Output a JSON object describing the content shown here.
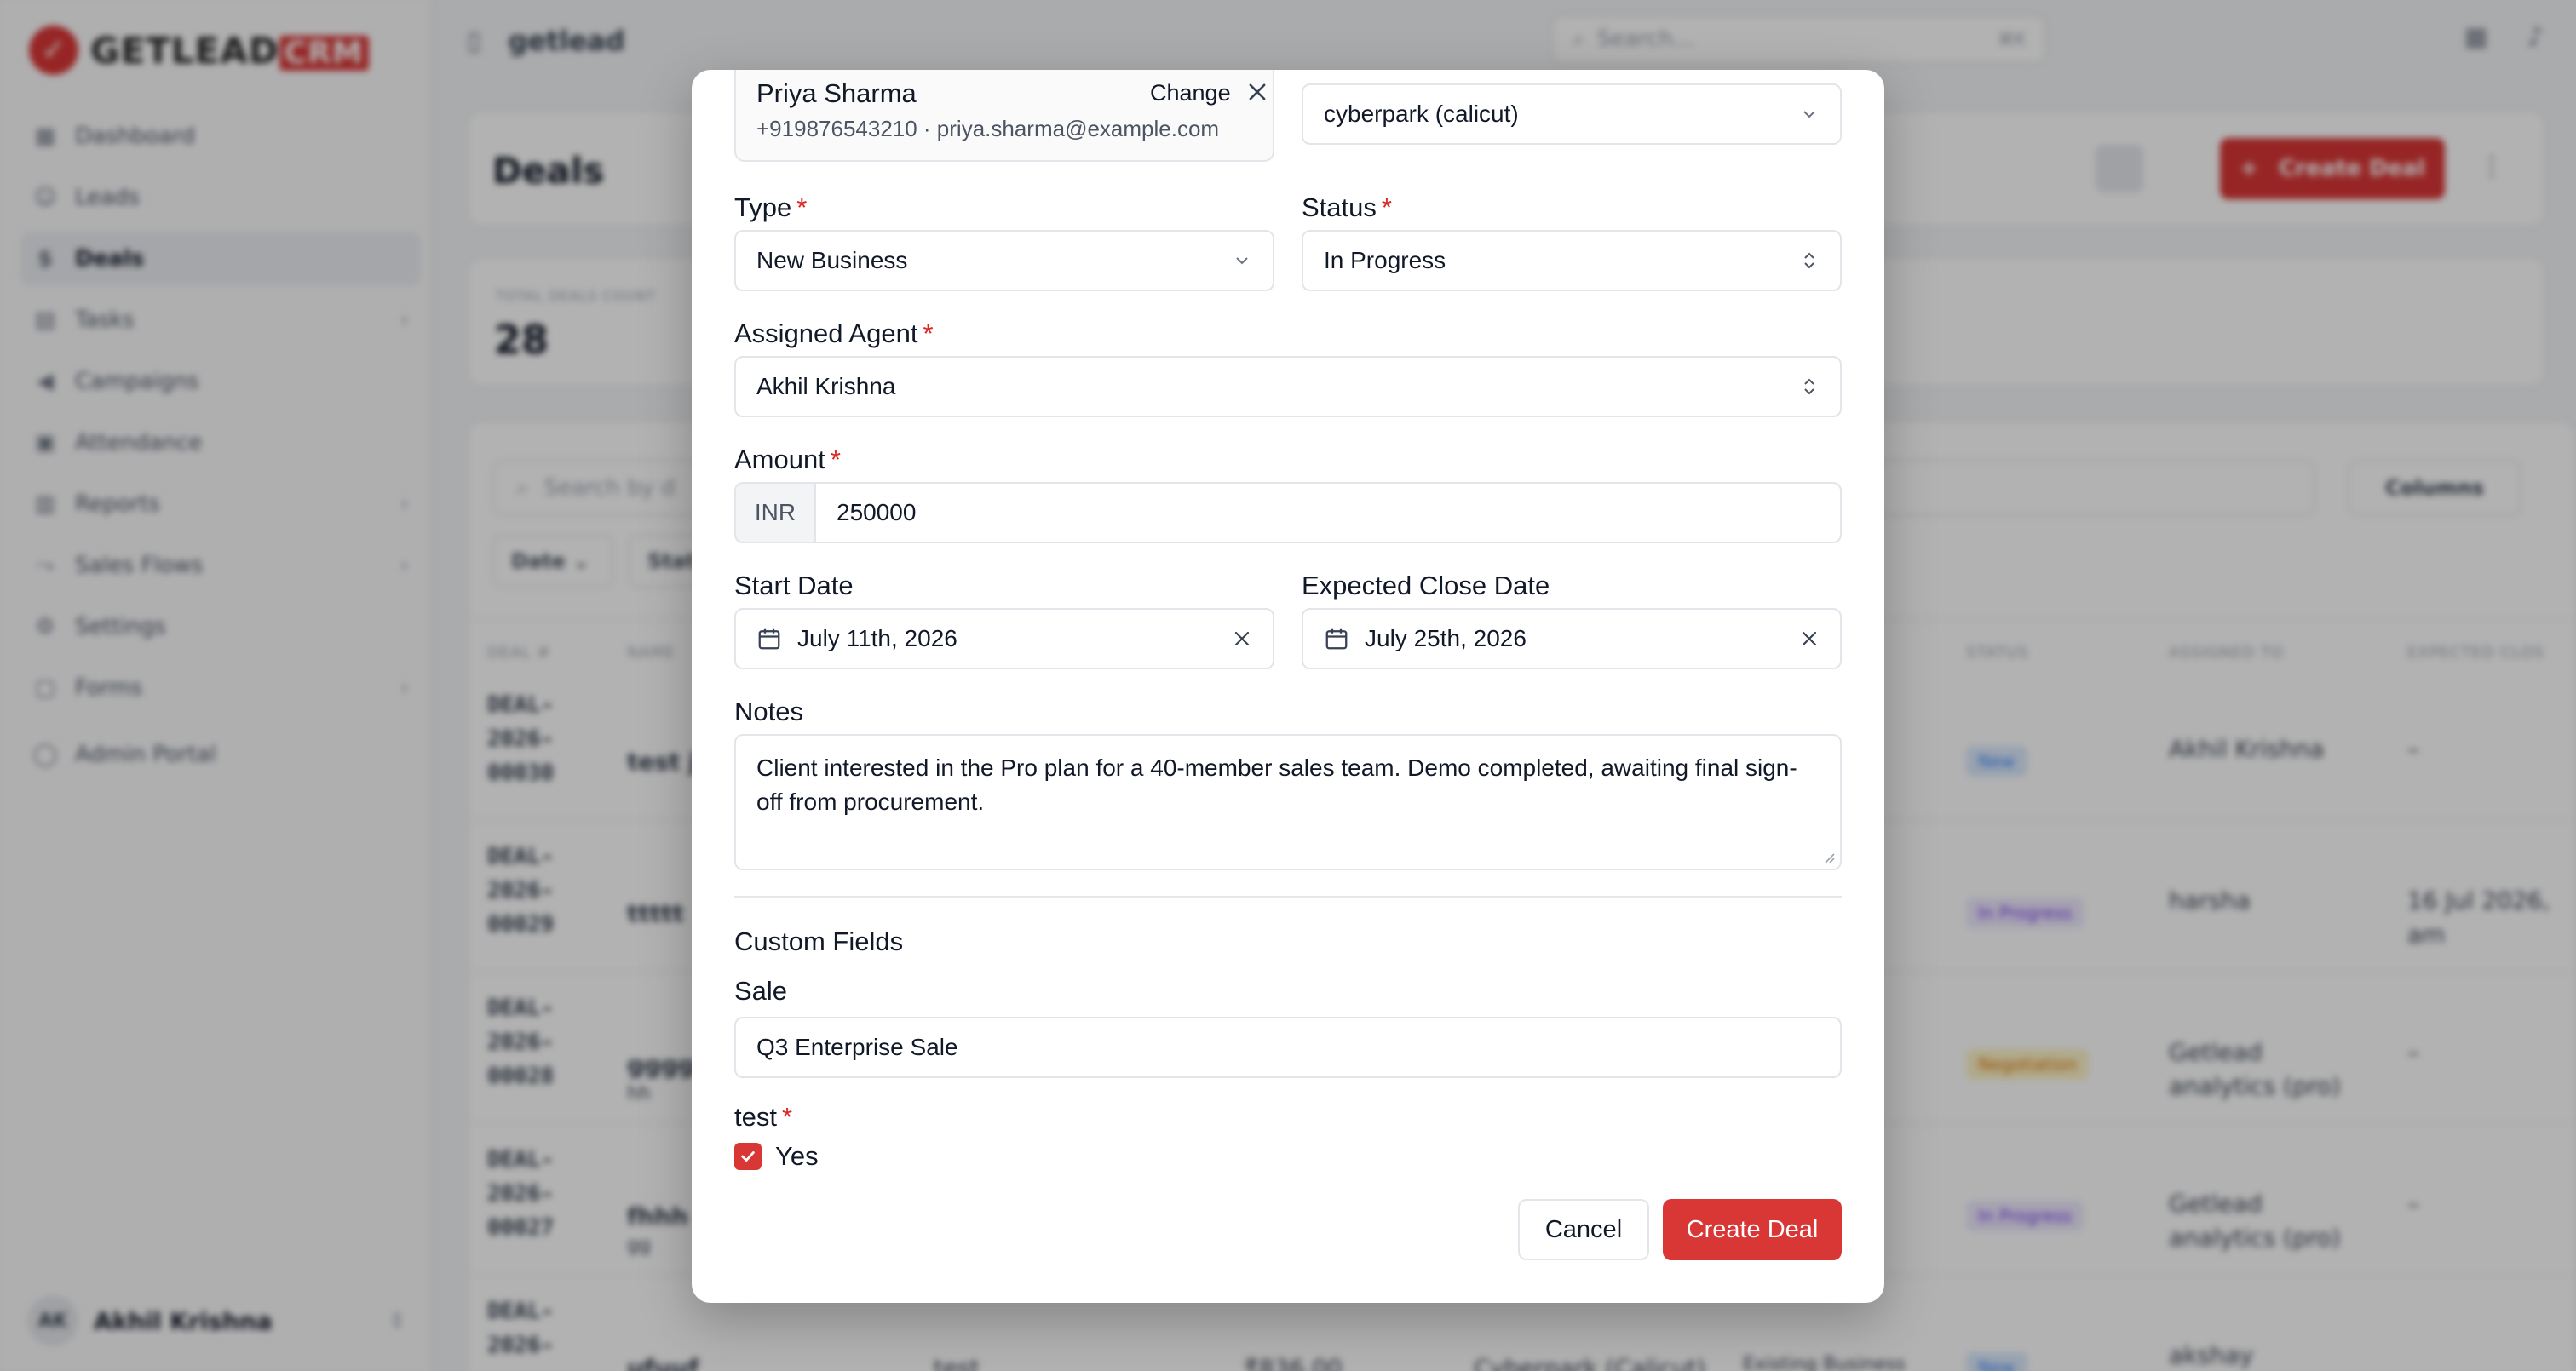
{
  "app": {
    "logo": {
      "mark": "✓",
      "text": "GETLEAD",
      "badge": "CRM"
    },
    "workspace": "getlead",
    "search_placeholder": "Search...",
    "search_shortcut": "⌘K",
    "nav": [
      {
        "label": "Dashboard",
        "icon": "grid-icon",
        "glyph": "▦",
        "has_children": false,
        "active": false
      },
      {
        "label": "Leads",
        "icon": "users-icon",
        "glyph": "☺",
        "has_children": false,
        "active": false
      },
      {
        "label": "Deals",
        "icon": "dollar-icon",
        "glyph": "$",
        "has_children": false,
        "active": true
      },
      {
        "label": "Tasks",
        "icon": "clipboard-icon",
        "glyph": "▤",
        "has_children": true,
        "active": false
      },
      {
        "label": "Campaigns",
        "icon": "megaphone-icon",
        "glyph": "◀",
        "has_children": false,
        "active": false
      },
      {
        "label": "Attendance",
        "icon": "calendar-icon",
        "glyph": "▣",
        "has_children": false,
        "active": false
      },
      {
        "label": "Reports",
        "icon": "bar-chart-icon",
        "glyph": "▥",
        "has_children": true,
        "active": false
      },
      {
        "label": "Sales Flows",
        "icon": "flow-icon",
        "glyph": "⤳",
        "has_children": true,
        "active": false
      },
      {
        "label": "Settings",
        "icon": "gear-icon",
        "glyph": "⚙",
        "has_children": false,
        "active": false
      },
      {
        "label": "Forms",
        "icon": "form-icon",
        "glyph": "▢",
        "has_children": true,
        "active": false
      },
      {
        "label": "Admin Portal",
        "icon": "shield-icon",
        "glyph": "◯",
        "has_children": false,
        "active": false
      }
    ],
    "user": {
      "initials": "AK",
      "name": "Akhil Krishna"
    }
  },
  "page": {
    "title": "Deals",
    "create_button": "Create Deal",
    "stat_label": "TOTAL DEALS COUNT",
    "stat_value": "28",
    "search_placeholder": "Search by d",
    "columns_button": "Columns",
    "filters": [
      "Date",
      "Stat"
    ],
    "table_headers": [
      "DEAL #",
      "NAME",
      "STATUS",
      "ASSIGNED TO",
      "EXPECTED CLOS"
    ],
    "rows": [
      {
        "deal": "DEAL-\n2026-\n00030",
        "name": "test ju",
        "sub": "",
        "status": "New",
        "status_color": "#dbeafe",
        "status_text": "#3b82f6",
        "assigned": "Akhil Krishna",
        "expected": "–"
      },
      {
        "deal": "DEAL-\n2026-\n00029",
        "name": "ttttt",
        "sub": "",
        "status": "In Progress",
        "status_color": "#ede9fe",
        "status_text": "#7c3aed",
        "assigned": "harsha",
        "expected": "16 Jul 2026,\nam"
      },
      {
        "deal": "DEAL-\n2026-\n00028",
        "name": "gggg",
        "sub": "hh",
        "status": "Negotiation",
        "status_color": "#fef3c7",
        "status_text": "#d97706",
        "assigned": "Getlead\nanalytics (pro)",
        "expected": "–"
      },
      {
        "deal": "DEAL-\n2026-\n00027",
        "name": "fhhh",
        "sub": "gg",
        "status": "In Progress",
        "status_color": "#ede9fe",
        "status_text": "#7c3aed",
        "assigned": "Getlead\nanalytics (pro)",
        "expected": "–"
      },
      {
        "deal": "DEAL-\n2026-",
        "name": "ufuuf",
        "sub": "",
        "status": "New",
        "status_color": "#dbeafe",
        "status_text": "#3b82f6",
        "assigned": "akshay",
        "expected": ""
      }
    ],
    "row_extra": {
      "col_a": "test",
      "col_b": "₹836.00",
      "col_c": "Cyberpark (Calicut)",
      "col_d": "Existing Business"
    }
  },
  "modal": {
    "contact": {
      "name": "Priya Sharma",
      "details": "+919876543210 · priya.sharma@example.com",
      "change_label": "Change"
    },
    "branch_value": "cyberpark (calicut)",
    "type": {
      "label": "Type",
      "value": "New Business"
    },
    "status": {
      "label": "Status",
      "value": "In Progress"
    },
    "agent": {
      "label": "Assigned Agent",
      "value": "Akhil Krishna"
    },
    "amount": {
      "label": "Amount",
      "currency": "INR",
      "value": "250000"
    },
    "start_date": {
      "label": "Start Date",
      "value": "July 11th, 2026"
    },
    "close_date": {
      "label": "Expected Close Date",
      "value": "July 25th, 2026"
    },
    "notes": {
      "label": "Notes",
      "value": "Client interested in the Pro plan for a 40-member sales team. Demo completed, awaiting final sign-off from procurement."
    },
    "custom_fields_title": "Custom Fields",
    "sale": {
      "label": "Sale",
      "value": "Q3 Enterprise Sale"
    },
    "test": {
      "label": "test",
      "checkbox_label": "Yes",
      "checked": true
    },
    "cancel_label": "Cancel",
    "create_label": "Create Deal",
    "required_mark": "*"
  },
  "colors": {
    "brand": "#d93636",
    "required": "#dc2626"
  }
}
